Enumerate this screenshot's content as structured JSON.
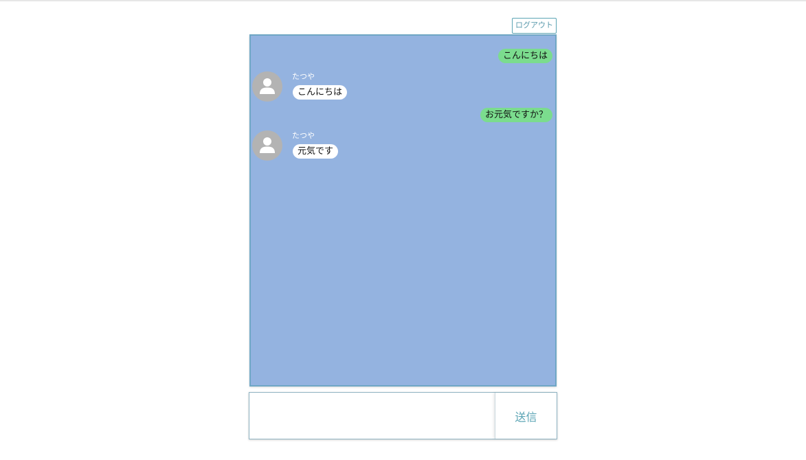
{
  "header": {
    "logout_label": "ログアウト"
  },
  "chat": {
    "background_color": "#94b3e0",
    "my_bubble_color": "#7bdc8e",
    "messages": [
      {
        "from": "me",
        "text": "こんにちは"
      },
      {
        "from": "other",
        "sender": "たつや",
        "avatar": "user-icon",
        "text": "こんにちは"
      },
      {
        "from": "me",
        "text": "お元気ですか？"
      },
      {
        "from": "other",
        "sender": "たつや",
        "avatar": "user-icon",
        "text": "元気です"
      }
    ]
  },
  "composer": {
    "input_value": "",
    "send_label": "送信"
  }
}
